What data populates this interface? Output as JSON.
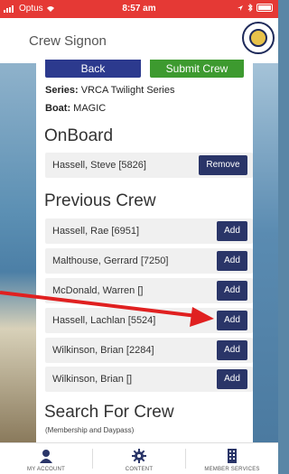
{
  "status_bar": {
    "carrier": "Optus",
    "time": "8:57 am"
  },
  "header": {
    "title": "Crew Signon"
  },
  "actions": {
    "back_label": "Back",
    "submit_label": "Submit Crew"
  },
  "meta": {
    "series_label": "Series:",
    "series_value": "VRCA Twilight Series",
    "boat_label": "Boat:",
    "boat_value": "MAGIC"
  },
  "onboard": {
    "title": "OnBoard",
    "items": [
      {
        "name": "Hassell, Steve [5826]",
        "action": "Remove"
      }
    ]
  },
  "previous_crew": {
    "title": "Previous Crew",
    "items": [
      {
        "name": "Hassell, Rae [6951]",
        "action": "Add"
      },
      {
        "name": "Malthouse, Gerrard [7250]",
        "action": "Add"
      },
      {
        "name": "McDonald, Warren []",
        "action": "Add"
      },
      {
        "name": "Hassell, Lachlan [5524]",
        "action": "Add"
      },
      {
        "name": "Wilkinson, Brian [2284]",
        "action": "Add"
      },
      {
        "name": "Wilkinson, Brian []",
        "action": "Add"
      }
    ]
  },
  "search": {
    "title": "Search For Crew",
    "subtitle": "(Membership and Daypass)"
  },
  "bottom_nav": {
    "items": [
      {
        "label": "MY ACCOUNT",
        "icon": "person-icon"
      },
      {
        "label": "CONTENT",
        "icon": "gear-icon"
      },
      {
        "label": "MEMBER SERVICES",
        "icon": "building-icon"
      }
    ]
  },
  "colors": {
    "status_bar": "#e53935",
    "primary_button": "#2c3a8e",
    "submit_button": "#3d9a2f",
    "action_button": "#2a3568",
    "annotation_arrow": "#e02020"
  }
}
